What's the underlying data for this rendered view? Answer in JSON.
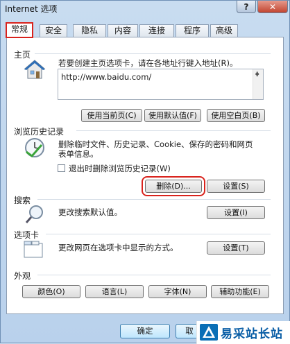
{
  "window": {
    "title": "Internet 选项",
    "help_label": "?",
    "close_label": "✕"
  },
  "tabs": [
    {
      "label": "常规"
    },
    {
      "label": "安全"
    },
    {
      "label": "隐私"
    },
    {
      "label": "内容"
    },
    {
      "label": "连接"
    },
    {
      "label": "程序"
    },
    {
      "label": "高级"
    }
  ],
  "homepage": {
    "title": "主页",
    "description": "若要创建主页选项卡，请在各地址行键入地址(R)。",
    "url": "http://www.baidu.com/",
    "use_current": "使用当前页(C)",
    "use_default": "使用默认值(F)",
    "use_blank": "使用空白页(B)"
  },
  "history": {
    "title": "浏览历史记录",
    "description_line1": "删除临时文件、历史记录、Cookie、保存的密码和网页",
    "description_line2": "表单信息。",
    "checkbox_label": "退出时删除浏览历史记录(W)",
    "checkbox_checked": false,
    "delete_label": "删除(D)...",
    "settings_label": "设置(S)"
  },
  "search": {
    "title": "搜索",
    "description": "更改搜索默认值。",
    "settings_label": "设置(I)"
  },
  "tabs_section": {
    "title": "选项卡",
    "description": "更改网页在选项卡中显示的方式。",
    "settings_label": "设置(T)"
  },
  "appearance": {
    "title": "外观",
    "colors": "颜色(O)",
    "languages": "语言(L)",
    "fonts": "字体(N)",
    "accessibility": "辅助功能(E)"
  },
  "footer": {
    "ok": "确定",
    "cancel": "取"
  },
  "watermark": {
    "text": "易采站长站"
  },
  "colors": {
    "highlight": "#d9221c",
    "panel_border": "#8c9db3"
  }
}
